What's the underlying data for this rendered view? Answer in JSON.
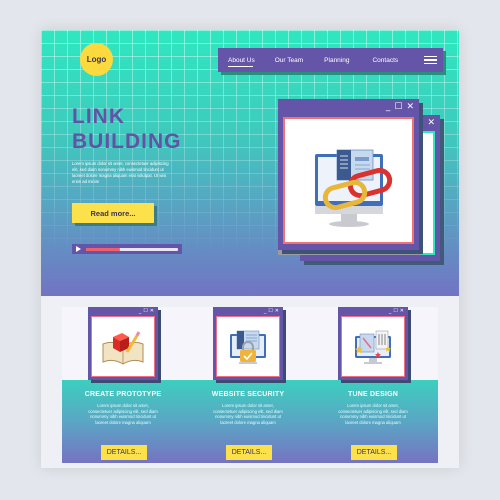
{
  "hero": {
    "logo_label": "Logo",
    "nav": {
      "items": [
        {
          "label": "About Us",
          "active": true
        },
        {
          "label": "Our Team",
          "active": false
        },
        {
          "label": "Planning",
          "active": false
        },
        {
          "label": "Contacts",
          "active": false
        }
      ],
      "menu_icon": "hamburger-menu-icon"
    },
    "title_line1": "LINK",
    "title_line2": "BUILDING",
    "body_text": "Lorem ipsum dolor sit amet, consectetuer adipiscing elit, sed diam nonummy nibh euismod tincidunt ut laoreet dolore magna aliquam erat volutpat. Ut wisi enim ad minim",
    "read_more_label": "Read more...",
    "player": {
      "progress_percent": 37,
      "play_icon": "play-icon"
    },
    "window": {
      "controls": [
        "_",
        "☐",
        "✕"
      ],
      "illustration": "monitor-with-chain-link-icon"
    },
    "back_window": {
      "controls": [
        "✕"
      ]
    }
  },
  "cards": [
    {
      "title": "CREATE PROTOTYPE",
      "text": "Lorem ipsum dolor sit amet, consectetuer adipiscing elit, sed diam nonummy nibh euismod tincidunt ut laoreet dolore magna aliquam",
      "button_label": "DETAILS...",
      "illustration": "book-with-cube-and-pencil-icon",
      "controls": [
        "_",
        "☐",
        "✕"
      ]
    },
    {
      "title": "WEBSITE SECURITY",
      "text": "Lorem ipsum dolor sit amet, consectetuer adipiscing elit, sed diam nonummy nibh euismod tincidunt ut laoreet dolore magna aliquam",
      "button_label": "DETAILS...",
      "illustration": "monitor-with-padlock-icon",
      "controls": [
        "_",
        "☐",
        "✕"
      ]
    },
    {
      "title": "TUNE DESIGN",
      "text": "Lorem ipsum dolor sit amet, consectetuer adipiscing elit, sed diam nonummy nibh euismod tincidunt ut laoreet dolore magna aliquam",
      "button_label": "DETAILS...",
      "illustration": "monitor-with-design-tools-icon",
      "controls": [
        "_",
        "☐",
        "✕"
      ]
    }
  ],
  "colors": {
    "purple": "#6455a8",
    "teal": "#2ee8c0",
    "yellow": "#fce14a",
    "logo_yellow": "#fcd93d",
    "red_accent": "#f0606a",
    "background": "#e3e6ec"
  }
}
